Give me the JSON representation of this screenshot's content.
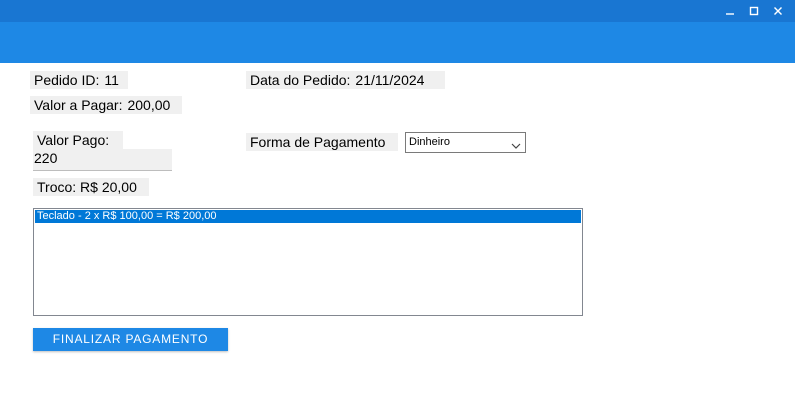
{
  "window": {
    "controls": {
      "minimize": "–",
      "maximize": "□",
      "close": "✕"
    }
  },
  "colors": {
    "titlebar": "#1976d2",
    "header": "#1e88e5",
    "label_bg": "#f0f0f0",
    "selection": "#0078d7",
    "button": "#1e88e5"
  },
  "order": {
    "id_label": "Pedido ID:",
    "id_value": "11",
    "date_label": "Data do Pedido:",
    "date_value": "21/11/2024",
    "amount_due_label": "Valor a Pagar:",
    "amount_due_value": "200,00"
  },
  "payment": {
    "paid_label": "Valor Pago:",
    "paid_value": "220",
    "method_label": "Forma de Pagamento",
    "method_selected": "Dinheiro",
    "change_text": "Troco: R$ 20,00"
  },
  "items": [
    "Teclado - 2 x R$ 100,00 = R$ 200,00"
  ],
  "actions": {
    "finalize_label": "FINALIZAR PAGAMENTO"
  },
  "icons": {
    "select_arrow": "chevron-down-icon"
  }
}
